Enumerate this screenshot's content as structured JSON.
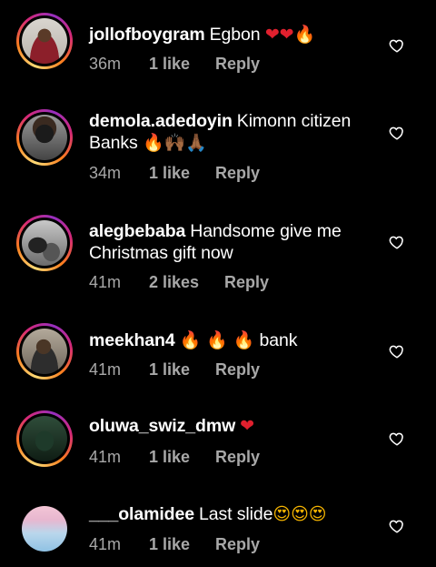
{
  "comments": [
    {
      "username": "jollofboygram",
      "text": "Egbon",
      "emoji": "❤❤🔥",
      "time": "36m",
      "likes": "1 like",
      "reply": "Reply"
    },
    {
      "username": "demola.adedoyin",
      "text": "Kimonn citizen",
      "text2": "Banks",
      "emoji": "🔥🙌🏾🙏🏾",
      "time": "34m",
      "likes": "1 like",
      "reply": "Reply"
    },
    {
      "username": "alegbebaba",
      "text": "Handsome give me",
      "text2": "Christmas gift now",
      "time": "41m",
      "likes": "2 likes",
      "reply": "Reply"
    },
    {
      "username": "meekhan4",
      "emoji": "🔥 🔥 🔥",
      "text": "bank",
      "time": "41m",
      "likes": "1 like",
      "reply": "Reply"
    },
    {
      "username": "oluwa_swiz_dmw",
      "emoji": "❤",
      "time": "41m",
      "likes": "1 like",
      "reply": "Reply"
    },
    {
      "username": "___olamidee",
      "text": "Last slide",
      "emoji": "😍😍😍",
      "time": "41m",
      "likes": "1 like",
      "reply": "Reply"
    }
  ],
  "icons": {
    "like": "heart-outline-icon",
    "heart_color": "#ffffff",
    "emoji_heart_color": "#e0202e",
    "fire_color": "#f77f00"
  }
}
